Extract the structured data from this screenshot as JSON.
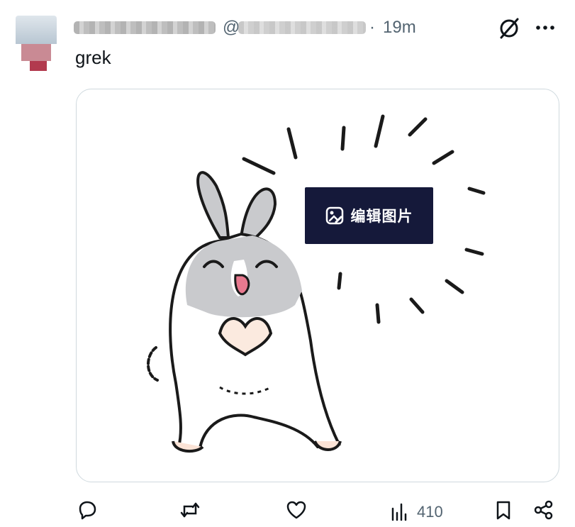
{
  "post": {
    "author_name": "",
    "at_sign": "@",
    "handle": "",
    "separator": "·",
    "timestamp": "19m",
    "text": "grek"
  },
  "media": {
    "badge_label": "编辑图片"
  },
  "actions": {
    "views_count": "410"
  },
  "icons": [
    "grok-icon",
    "more-icon",
    "reply-icon",
    "repost-icon",
    "like-icon",
    "views-icon",
    "bookmark-icon",
    "share-icon",
    "edit-image-icon"
  ],
  "colors": {
    "text": "#0f1419",
    "muted": "#536471",
    "badge_bg": "#15193a",
    "card_border": "#cfd9de"
  }
}
